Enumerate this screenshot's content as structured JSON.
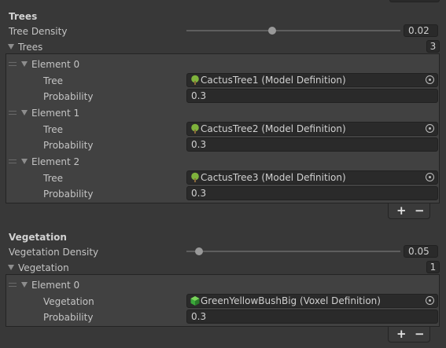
{
  "trees_section": {
    "header": "Trees",
    "density_label": "Tree Density",
    "density_value": "0.02",
    "density_fraction": 0.4,
    "list_label": "Trees",
    "count": "3",
    "elements": [
      {
        "label": "Element 0",
        "tree_label": "Tree",
        "tree_value": "CactusTree1 (Model Definition)",
        "probability_label": "Probability",
        "probability_value": "0.3"
      },
      {
        "label": "Element 1",
        "tree_label": "Tree",
        "tree_value": "CactusTree2 (Model Definition)",
        "probability_label": "Probability",
        "probability_value": "0.3"
      },
      {
        "label": "Element 2",
        "tree_label": "Tree",
        "tree_value": "CactusTree3 (Model Definition)",
        "probability_label": "Probability",
        "probability_value": "0.3"
      }
    ],
    "add_label": "+",
    "remove_label": "−"
  },
  "vegetation_section": {
    "header": "Vegetation",
    "density_label": "Vegetation Density",
    "density_value": "0.05",
    "density_fraction": 0.06,
    "list_label": "Vegetation",
    "count": "1",
    "elements": [
      {
        "label": "Element 0",
        "field_label": "Vegetation",
        "field_value": "GreenYellowBushBig (Voxel Definition)",
        "probability_label": "Probability",
        "probability_value": "0.3"
      }
    ],
    "add_label": "+",
    "remove_label": "−"
  },
  "icons": {
    "model_icon": "tree-icon",
    "voxel_icon": "voxel-cube-icon",
    "picker_icon": "object-picker-icon",
    "foldout_icon": "foldout-triangle-icon",
    "drag_icon": "drag-handle-icon"
  },
  "colors": {
    "background": "#383838",
    "panel": "#414141",
    "field": "#2a2a2a",
    "tree_icon": "#7fb33c",
    "voxel_icon": "#3aa83a"
  }
}
